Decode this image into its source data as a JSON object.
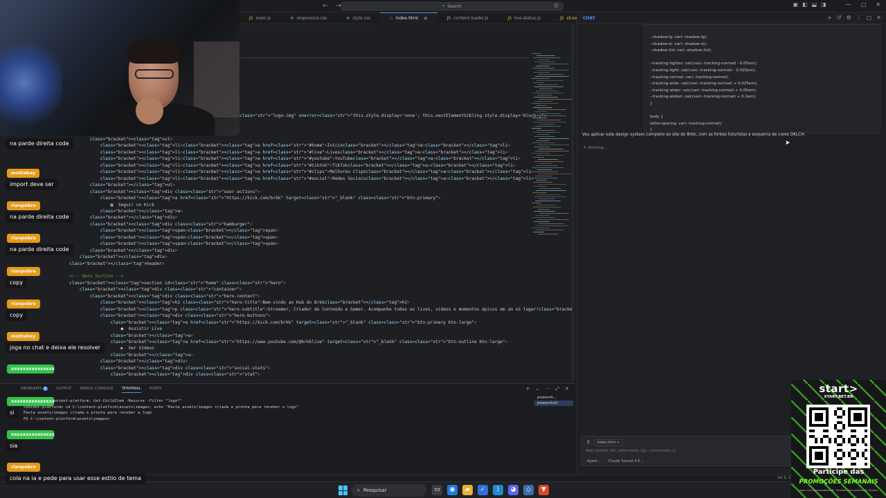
{
  "titlebar": {
    "search_label": "Search",
    "back_icon": "arrow-left-icon",
    "forward_icon": "arrow-right-icon"
  },
  "tabs": [
    {
      "label": "main.js",
      "icon": "js-file-icon",
      "active": false
    },
    {
      "label": "responsive.css",
      "icon": "css-file-icon",
      "active": false
    },
    {
      "label": "style.css",
      "icon": "css-file-icon",
      "active": false
    },
    {
      "label": "index.html",
      "icon": "html-file-icon",
      "active": true
    },
    {
      "label": "content-loader.js",
      "icon": "js-file-icon",
      "active": false
    },
    {
      "label": "live-status.js",
      "icon": "js-file-icon",
      "active": false
    },
    {
      "label": "streamer",
      "icon": "js-file-icon",
      "active": false
    }
  ],
  "code_lines": [
    {
      "t": "\"logo-img\" onerror=\"this.style.display='none'; this.nextElementSibling.style.display='block';\">"
    },
    {
      "t": "        <ul>"
    },
    {
      "t": "            <li><a href=\"#home\">Início</a></li>"
    },
    {
      "t": "            <li><a href=\"#live\">Lives</a></li>"
    },
    {
      "t": "            <li><a href=\"#youtube\">YouTube</a></li>"
    },
    {
      "t": "            <li><a href=\"#tiktok\">TikTok</a></li>"
    },
    {
      "t": "            <li><a href=\"#clips\">Melhores Clips</a></li>"
    },
    {
      "t": "            <li><a href=\"#social\">Redes Sociais</a></li>"
    },
    {
      "t": "        </ul>"
    },
    {
      "t": "        <div class=\"user-actions\">"
    },
    {
      "t": "            <a href=\"https://kick.com/brkk\" target=\"_blank\" class=\"btn-primary\">"
    },
    {
      "t": "                ▣  Seguir no Kick"
    },
    {
      "t": "            </a>"
    },
    {
      "t": "        </div>"
    },
    {
      "t": "        <div class=\"hamburger\">"
    },
    {
      "t": "            <span></span>"
    },
    {
      "t": "            <span></span>"
    },
    {
      "t": "            <span></span>"
    },
    {
      "t": "        </div>"
    },
    {
      "t": "    </div>"
    },
    {
      "t": "</header>"
    },
    {
      "t": ""
    },
    {
      "t": "<!-- Hero Section -->"
    },
    {
      "t": "<section id=\"home\" class=\"hero\">"
    },
    {
      "t": "    <div class=\"container\">"
    },
    {
      "t": "        <div class=\"hero-content\">"
    },
    {
      "t": "            <h2 class=\"hero-title\">Bem-vindo ao Hub do Brkk</h2>"
    },
    {
      "t": "            <p class=\"hero-subtitle\">Streamer, Criador de Conteúdo e Gamer. Acompanhe todas as lives, vídeos e momentos épicos em um só lugar!</p>"
    },
    {
      "t": "            <div class=\"hero-buttons\">"
    },
    {
      "t": "                <a href=\"https://kick.com/brkk\" target=\"_blank\" class=\"btn-primary btn-large\">"
    },
    {
      "t": "                    ●  Assistir Live"
    },
    {
      "t": "                </a>"
    },
    {
      "t": "                <a href=\"https://www.youtube.com/@brkklive\" target=\"_blank\" class=\"btn-outline btn-large\">"
    },
    {
      "t": "                    ▶  Ver Vídeos"
    },
    {
      "t": "                </a>"
    },
    {
      "t": "            </div>"
    },
    {
      "t": "            <div class=\"social-stats\">"
    },
    {
      "t": "                <div class=\"stat\">"
    }
  ],
  "panel": {
    "tabs": [
      "PROBLEMS",
      "OUTPUT",
      "DEBUG CONSOLE",
      "TERMINAL",
      "PORTS"
    ],
    "problems_count": "6",
    "terminal_lines": [
      "brkk> cd C:\\content-platform; Get-ChildItem -Recurse -Filter \"logo*\"",
      "content-platform> cd C:\\content-platform\\assets\\images; echo \"Pasta assets/images criada e pronta para receber o logo\"",
      "Pasta assets/images criada e pronta para receber a logo",
      "PS C:\\content-platform\\assets\\images>"
    ],
    "shells": [
      "powersh...",
      "powershell"
    ]
  },
  "chat": {
    "title": "CHAT",
    "code_lines": [
      "--shadow-lg: var(--shadow-lg);",
      "--shadow-xl: var(--shadow-xl);",
      "--shadow-2xl: var(--shadow-2xl);",
      "",
      "--tracking-tighter: calc(var(--tracking-normal) - 0.05em);",
      "--tracking-tight: calc(var(--tracking-normal) - 0.025em);",
      "--tracking-normal: var(--tracking-normal);",
      "--tracking-wide: calc(var(--tracking-normal) + 0.025em);",
      "--tracking-wider: calc(var(--tracking-normal) + 0.05em);",
      "--tracking-widest: calc(var(--tracking-normal) + 0.1em);",
      "}",
      "",
      "body {",
      "letter-spacing: var(--tracking-normal);",
      "}"
    ],
    "message": "Vou aplicar este design system completo ao site do Brkk, com as fontes futuristas e esquema de cores OKLCH:",
    "status": "Working...",
    "input_file": "index.html",
    "input_placeholder": "Add context (#), extensions (@), commands (/)",
    "mode": "Agent",
    "model": "Claude Sonnet 4.5"
  },
  "twitch_chat": [
    {
      "user": "",
      "text": "na parde direita code",
      "color": "none"
    },
    {
      "user": "mottaboy",
      "text": "import deve ser",
      "color": "orange"
    },
    {
      "user": "rianpobre",
      "text": "na parde direita code",
      "color": "orange"
    },
    {
      "user": "rianpobre",
      "text": "na parde direita code",
      "color": "orange"
    },
    {
      "user": "rianpobre",
      "text": "copy",
      "color": "orange"
    },
    {
      "user": "rianpobre",
      "text": "copy",
      "color": "orange"
    },
    {
      "user": "mottaboy",
      "text": "joga no chat e deixa ele resolver",
      "color": "orange"
    },
    {
      "user": "xxxxxxxxxxxxxxx",
      "text": "",
      "color": "green"
    },
    {
      "user": "xxxxxxxxxxxxxxx",
      "text": "si",
      "color": "green"
    },
    {
      "user": "xxxxxxxxxxxxxxx",
      "text": "sia",
      "color": "green"
    },
    {
      "user": "rianpobre",
      "text": "cola na ia e pede para usar esse estilo de tema",
      "color": "orange"
    }
  ],
  "statusbar": {
    "position": "Ln 1, C"
  },
  "taskbar": {
    "search_label": "Pesquisar",
    "icons": [
      "windows-start-icon",
      "search-icon",
      "task-view-icon",
      "chrome-icon",
      "file-explorer-icon",
      "todo-icon",
      "vscode-icon",
      "discord-icon",
      "app-icon",
      "brave-icon"
    ]
  },
  "promo": {
    "brand": "start>",
    "site": "START.BET.BR",
    "line1": "Participe das",
    "line2": "PROMOÇÕES SEMANAIS",
    "fine": "Jogue com Responsabilidade · Proibido para menores de 18 anos"
  },
  "colors": {
    "accent": "#4a8cff",
    "twitch_orange": "#e49a1b",
    "twitch_green": "#35c24a",
    "promo_green": "#46d11f"
  }
}
